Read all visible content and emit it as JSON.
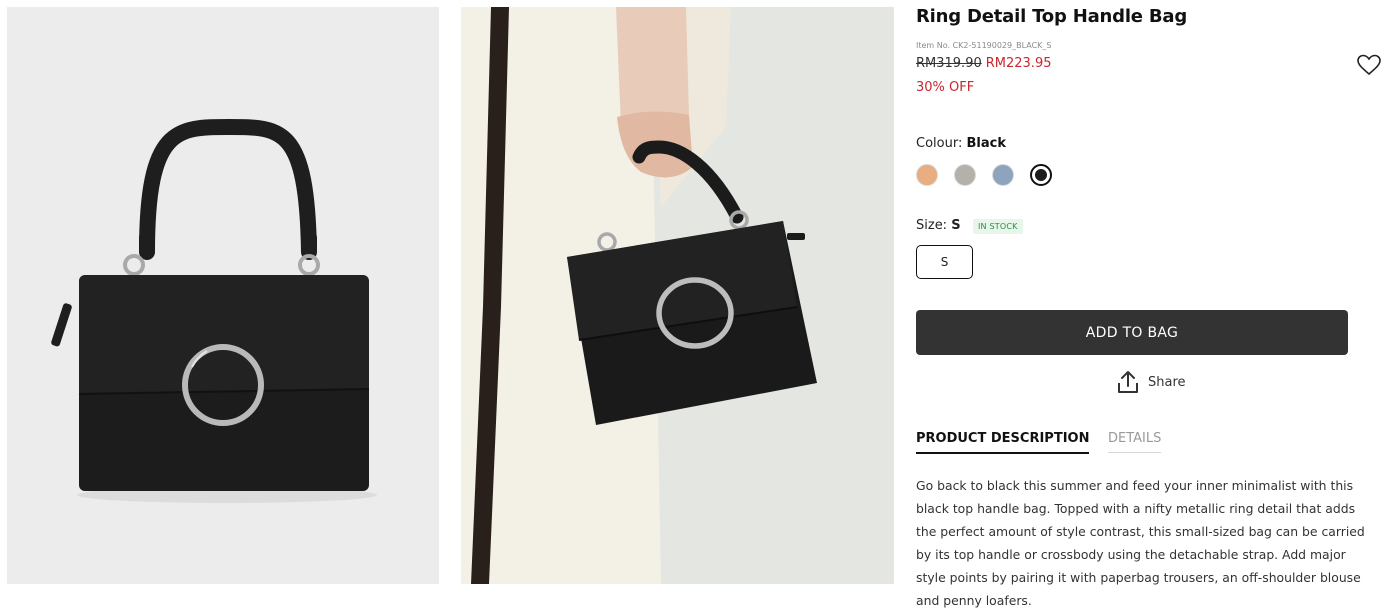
{
  "product": {
    "title": "Ring Detail Top Handle Bag",
    "item_no": "Item No. CK2-51190029_BLACK_S",
    "price_original": "RM319.90",
    "price_sale": "RM223.95",
    "discount": "30% OFF"
  },
  "colour": {
    "label": "Colour:",
    "selected": "Black",
    "swatches": [
      {
        "name": "Tan",
        "hex": "#e8ad80"
      },
      {
        "name": "Grey",
        "hex": "#b3b1a9"
      },
      {
        "name": "Denim",
        "hex": "#8ea3bd"
      },
      {
        "name": "Black",
        "hex": "#1b1b1b"
      }
    ]
  },
  "size": {
    "label": "Size:",
    "selected": "S",
    "stock_status": "IN STOCK",
    "options": [
      "S"
    ]
  },
  "actions": {
    "add_to_bag": "ADD TO BAG",
    "share": "Share"
  },
  "tabs": [
    {
      "label": "PRODUCT DESCRIPTION",
      "active": true
    },
    {
      "label": "DETAILS",
      "active": false
    }
  ],
  "description": "Go back to black this summer and feed your inner minimalist with this black top handle bag. Topped with a nifty metallic ring detail that adds the perfect amount of style contrast, this small-sized bag can be carried by its top handle or crossbody using the detachable strap. Add major style points by pairing it with paperbag trousers, an off-shoulder blouse and penny loafers.",
  "icons": {
    "wishlist": "heart-icon",
    "share": "share-upload-icon"
  },
  "colors": {
    "sale": "#c8262e",
    "button_bg": "#333333",
    "stock_green": "#2e8b45"
  }
}
